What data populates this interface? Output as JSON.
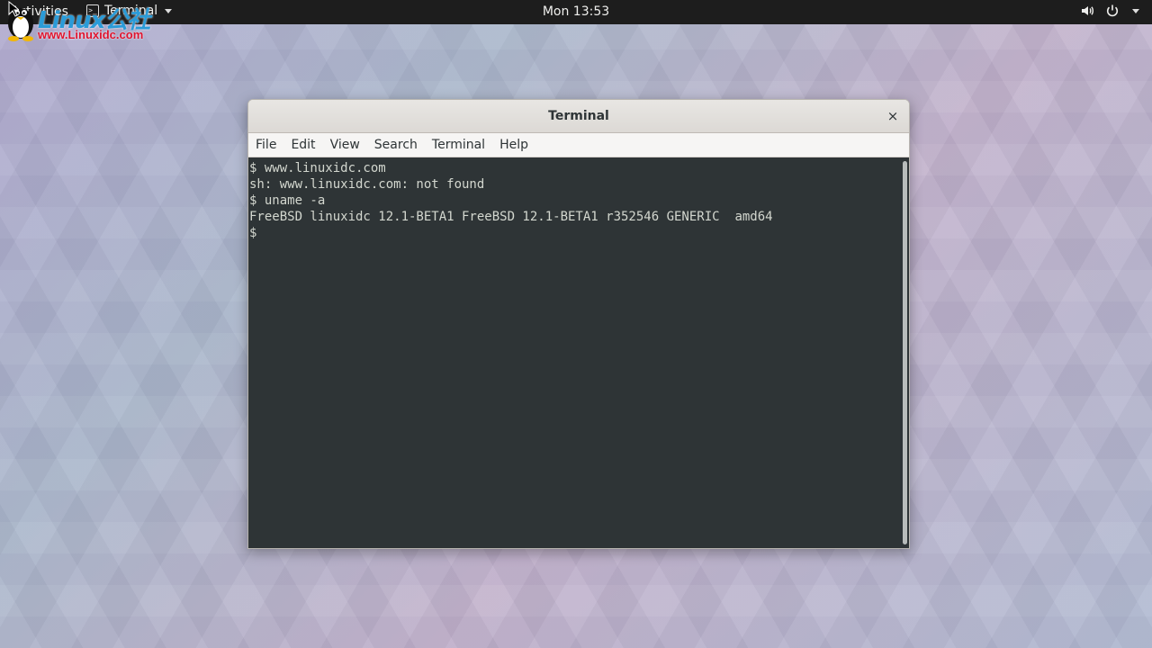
{
  "topbar": {
    "activities": "Activities",
    "app_menu_label": "Terminal",
    "clock": "Mon 13:53"
  },
  "watermark": {
    "title": "Linux公社",
    "url": "www.Linuxidc.com"
  },
  "window": {
    "title": "Terminal",
    "close_glyph": "×",
    "menu": [
      "File",
      "Edit",
      "View",
      "Search",
      "Terminal",
      "Help"
    ],
    "lines": [
      "$ www.linuxidc.com",
      "sh: www.linuxidc.com: not found",
      "$ uname -a",
      "FreeBSD linuxidc 12.1-BETA1 FreeBSD 12.1-BETA1 r352546 GENERIC  amd64",
      "$"
    ]
  },
  "icons": {
    "terminal_app": "terminal-icon",
    "volume": "volume-icon",
    "power": "power-icon",
    "menu_caret": "chevron-down-icon"
  },
  "colors": {
    "terminal_bg": "#2e3436",
    "terminal_fg": "#d3d7cf",
    "topbar_bg": "#1d1d1d"
  }
}
